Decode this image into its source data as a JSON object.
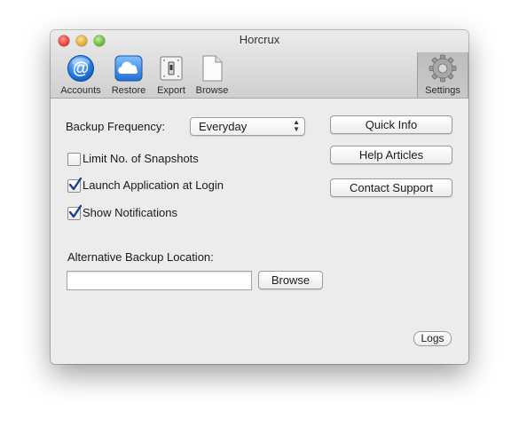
{
  "window": {
    "title": "Horcrux"
  },
  "toolbar": {
    "items": [
      {
        "label": "Accounts",
        "icon": "at-sign-icon"
      },
      {
        "label": "Restore",
        "icon": "cloud-icon"
      },
      {
        "label": "Export",
        "icon": "switch-icon"
      },
      {
        "label": "Browse",
        "icon": "document-icon"
      },
      {
        "label": "Settings",
        "icon": "gear-icon",
        "selected": true
      }
    ]
  },
  "settings": {
    "frequency_label": "Backup Frequency:",
    "frequency_value": "Everyday",
    "options": [
      {
        "label": "Limit No. of Snapshots",
        "checked": false
      },
      {
        "label": "Launch Application at Login",
        "checked": true
      },
      {
        "label": "Show Notifications",
        "checked": true
      }
    ],
    "alt_location_label": "Alternative Backup Location:",
    "alt_location_value": "",
    "browse_label": "Browse"
  },
  "side_buttons": {
    "quick_info": "Quick Info",
    "help_articles": "Help Articles",
    "contact_support": "Contact Support"
  },
  "logs_label": "Logs",
  "colors": {
    "accent": "#2a7fe6",
    "check": "#1d3f8f",
    "window_bg": "#ececec"
  }
}
